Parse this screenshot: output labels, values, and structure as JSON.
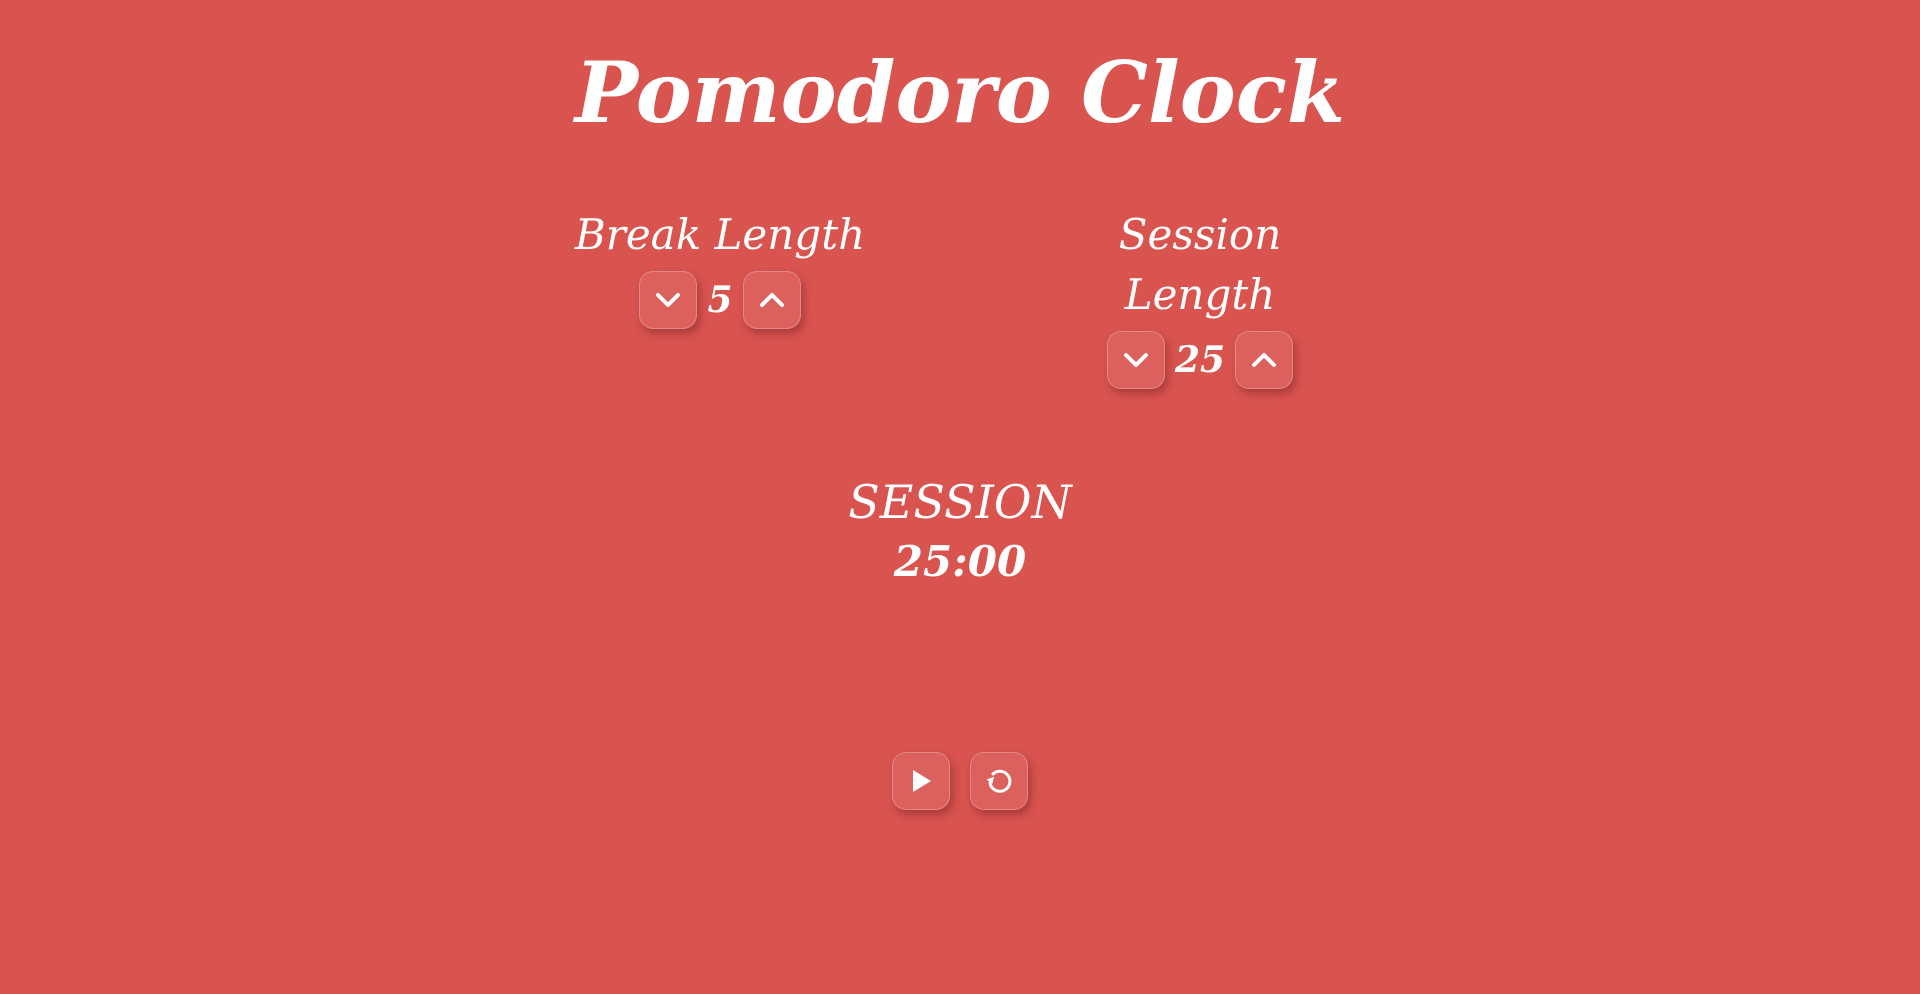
{
  "app": {
    "title": "Pomodoro Clock"
  },
  "break_control": {
    "label": "Break Length",
    "value": "5",
    "decrement_icon": "chevron-down-icon",
    "increment_icon": "chevron-up-icon"
  },
  "session_control": {
    "label": "Session Length",
    "value": "25",
    "decrement_icon": "chevron-down-icon",
    "increment_icon": "chevron-up-icon"
  },
  "timer": {
    "label": "SESSION",
    "time": "25:00"
  },
  "actions": {
    "play_icon": "play-icon",
    "reset_icon": "reset-icon"
  },
  "colors": {
    "background": "#d9534f",
    "text": "#ffffff"
  }
}
